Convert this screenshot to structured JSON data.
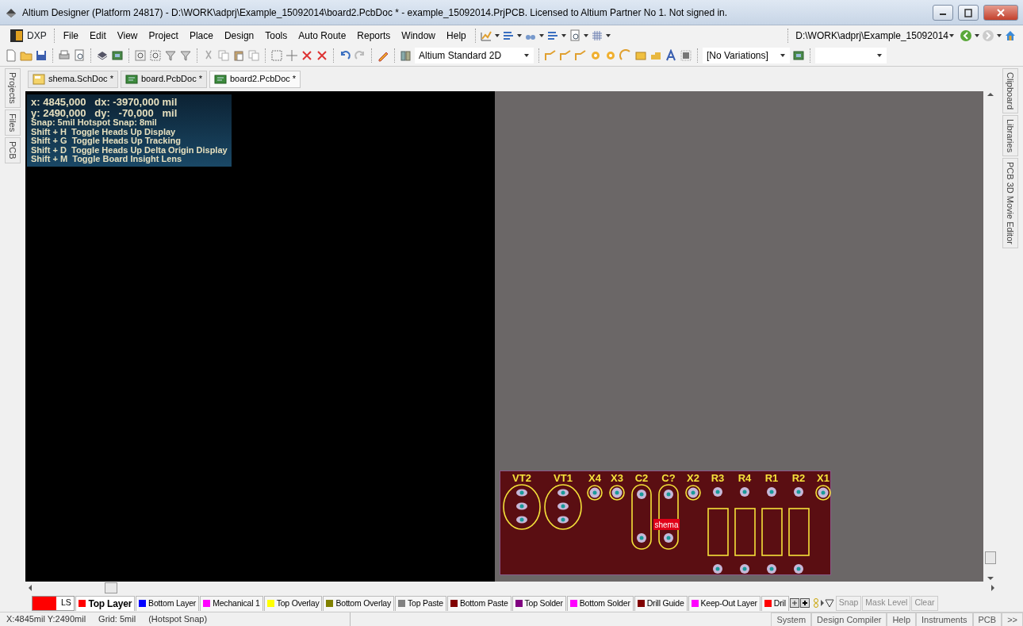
{
  "window": {
    "title": "Altium Designer (Platform 24817) - D:\\WORK\\adprj\\Example_15092014\\board2.PcbDoc * - example_15092014.PrjPCB. Licensed to Altium Partner No 1. Not signed in."
  },
  "menu_bar": {
    "dxp": "DXP",
    "items": [
      "File",
      "Edit",
      "View",
      "Project",
      "Place",
      "Design",
      "Tools",
      "Auto Route",
      "Reports",
      "Window",
      "Help"
    ],
    "project_path": "D:\\WORK\\adprj\\Example_15092014"
  },
  "toolbar": {
    "view_combo": "Altium Standard 2D",
    "variant_combo": "[No Variations]"
  },
  "doc_tabs": [
    {
      "label": "shema.SchDoc *",
      "kind": "sch",
      "selected": false
    },
    {
      "label": "board.PcbDoc *",
      "kind": "pcb",
      "selected": false
    },
    {
      "label": "board2.PcbDoc *",
      "kind": "pcb",
      "selected": true
    }
  ],
  "left_panels": [
    "Projects",
    "Files",
    "PCB"
  ],
  "right_panels": [
    "Clipboard",
    "Libraries",
    "PCB 3D Movie Editor"
  ],
  "heads_up": [
    {
      "text": "x: 4845,000   dx: -3970,000 mil",
      "kind": "coord"
    },
    {
      "text": "y: 2490,000   dy:   -70,000   mil",
      "kind": "coord"
    },
    {
      "text": "Snap: 5mil Hotspot Snap: 8mil",
      "kind": "info"
    },
    {
      "text": "Shift + H  Toggle Heads Up Display",
      "kind": "info"
    },
    {
      "text": "Shift + G  Toggle Heads Up Tracking",
      "kind": "info"
    },
    {
      "text": "Shift + D  Toggle Heads Up Delta Origin Display",
      "kind": "info"
    },
    {
      "text": "Shift + M  Toggle Board Insight Lens",
      "kind": "info"
    }
  ],
  "board": {
    "components": [
      {
        "designator": "VT2",
        "kind": "transistor"
      },
      {
        "designator": "VT1",
        "kind": "transistor"
      },
      {
        "designator": "X4",
        "kind": "pad"
      },
      {
        "designator": "X3",
        "kind": "pad"
      },
      {
        "designator": "C2",
        "kind": "capacitor"
      },
      {
        "designator": "C?",
        "kind": "capacitor",
        "tag": "shema"
      },
      {
        "designator": "X2",
        "kind": "pad"
      },
      {
        "designator": "R3",
        "kind": "resistor"
      },
      {
        "designator": "R4",
        "kind": "resistor"
      },
      {
        "designator": "R1",
        "kind": "resistor"
      },
      {
        "designator": "R2",
        "kind": "resistor"
      },
      {
        "designator": "X1",
        "kind": "pad"
      }
    ]
  },
  "layer_bar": {
    "ls": "LS",
    "layers": [
      {
        "label": "Top Layer",
        "color": "#ff0000",
        "selected": true
      },
      {
        "label": "Bottom Layer",
        "color": "#0000ff",
        "selected": false
      },
      {
        "label": "Mechanical 1",
        "color": "#ff00ff",
        "selected": false
      },
      {
        "label": "Top Overlay",
        "color": "#ffff00",
        "selected": false
      },
      {
        "label": "Bottom Overlay",
        "color": "#808000",
        "selected": false
      },
      {
        "label": "Top Paste",
        "color": "#808080",
        "selected": false
      },
      {
        "label": "Bottom Paste",
        "color": "#800000",
        "selected": false
      },
      {
        "label": "Top Solder",
        "color": "#800080",
        "selected": false
      },
      {
        "label": "Bottom Solder",
        "color": "#ff00ff",
        "selected": false
      },
      {
        "label": "Drill Guide",
        "color": "#800000",
        "selected": false
      },
      {
        "label": "Keep-Out Layer",
        "color": "#ff00ff",
        "selected": false
      },
      {
        "label": "Dril",
        "color": "#ff0000",
        "selected": false
      }
    ],
    "buttons": [
      "Snap",
      "Mask Level",
      "Clear"
    ]
  },
  "status_bar": {
    "items": [
      "X:4845mil Y:2490mil",
      "Grid: 5mil",
      "(Hotspot Snap)"
    ],
    "panels": [
      "System",
      "Design Compiler",
      "Help",
      "Instruments",
      "PCB",
      ">>"
    ]
  }
}
